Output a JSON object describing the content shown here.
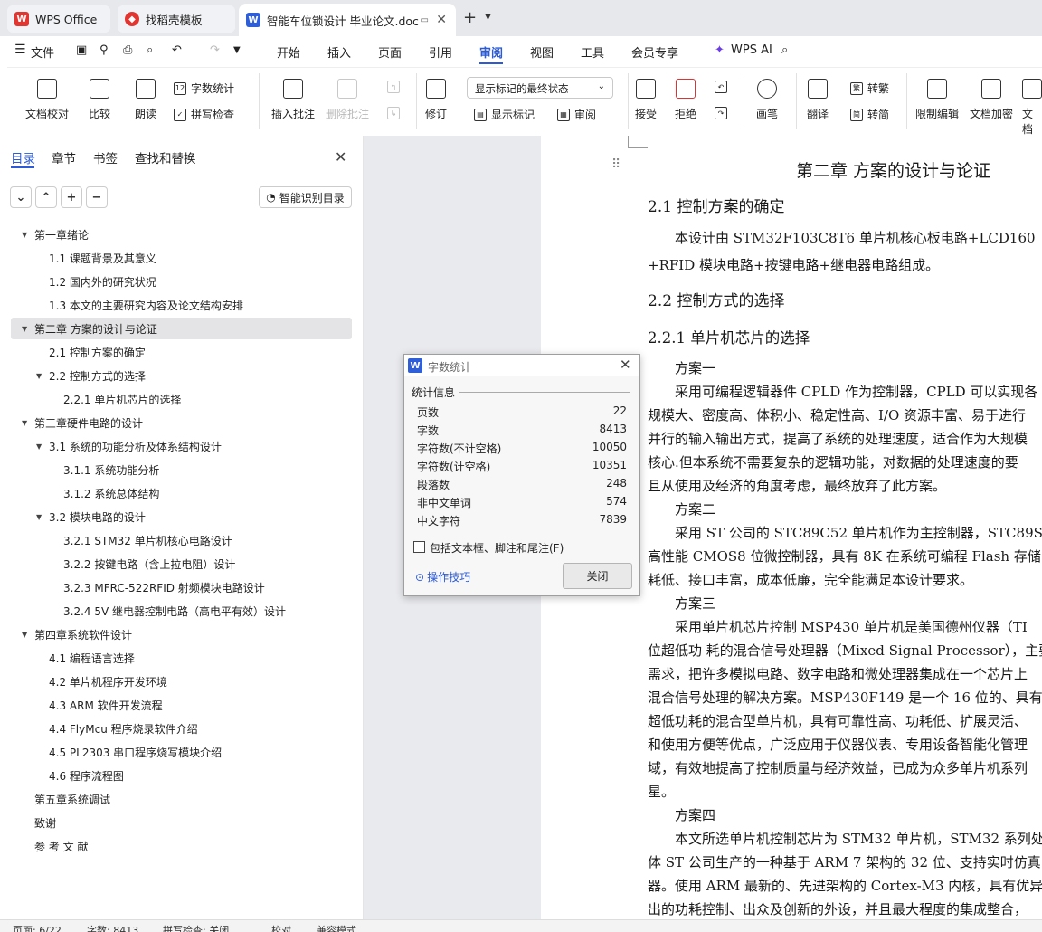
{
  "tabs": {
    "wps": "WPS Office",
    "template": "找稻壳模板",
    "doc": "智能车位锁设计 毕业论文.doc"
  },
  "menu": {
    "file": "文件",
    "items": [
      "开始",
      "插入",
      "页面",
      "引用",
      "审阅",
      "视图",
      "工具",
      "会员专享",
      "WPS AI"
    ]
  },
  "ribbon": {
    "doc_proof": "文档校对",
    "compare": "比较",
    "read": "朗读",
    "word_count": "字数统计",
    "spell_check": "拼写检查",
    "insert_comment": "插入批注",
    "delete_comment": "删除批注",
    "revise": "修订",
    "markup_state": "显示标记的最终状态",
    "show_markup": "显示标记",
    "review": "审阅",
    "accept": "接受",
    "reject": "拒绝",
    "pen": "画笔",
    "translate": "翻译",
    "to_traditional": "转繁",
    "to_simplified": "转简",
    "restrict_edit": "限制编辑",
    "doc_encrypt": "文档加密",
    "doc_cut": "文档"
  },
  "nav": {
    "tabs": [
      "目录",
      "章节",
      "书签",
      "查找和替换"
    ],
    "smart_toc": "智能识别目录",
    "toc": [
      "第一章绪论",
      "1.1 课题背景及其意义",
      "1.2 国内外的研究状况",
      "1.3 本文的主要研究内容及论文结构安排",
      "第二章  方案的设计与论证",
      "2.1 控制方案的确定",
      "2.2 控制方式的选择",
      "2.2.1  单片机芯片的选择",
      "第三章硬件电路的设计",
      "3.1 系统的功能分析及体系结构设计",
      "3.1.1 系统功能分析",
      "3.1.2 系统总体结构",
      "3.2 模块电路的设计",
      "3.2.1 STM32 单片机核心电路设计",
      "3.2.2  按键电路（含上拉电阻）设计",
      "3.2.3 MFRC-522RFID 射频模块电路设计",
      "3.2.4 5V 继电器控制电路（高电平有效）设计",
      "第四章系统软件设计",
      "4.1  编程语言选择",
      "4.2 单片机程序开发环境",
      "4.3 ARM 软件开发流程",
      "4.4 FlyMcu 程序烧录软件介绍",
      "4.5 PL2303 串口程序烧写模块介绍",
      "4.6  程序流程图",
      "第五章系统调试",
      "致谢",
      "参 考 文 献"
    ]
  },
  "dialog": {
    "title": "字数统计",
    "section": "统计信息",
    "stats": [
      {
        "label": "页数",
        "value": "22"
      },
      {
        "label": "字数",
        "value": "8413"
      },
      {
        "label": "字符数(不计空格)",
        "value": "10050"
      },
      {
        "label": "字符数(计空格)",
        "value": "10351"
      },
      {
        "label": "段落数",
        "value": "248"
      },
      {
        "label": "非中文单词",
        "value": "574"
      },
      {
        "label": "中文字符",
        "value": "7839"
      }
    ],
    "checkbox": "包括文本框、脚注和尾注(F)",
    "tips": "操作技巧",
    "close": "关闭"
  },
  "document": {
    "lines": [
      "第二章  方案的设计与论证",
      "2.1 控制方案的确定",
      "　　本设计由 STM32F103C8T6 单片机核心板电路+LCD160",
      "+RFID 模块电路+按键电路+继电器电路组成。",
      "2.2 控制方式的选择",
      "2.2.1  单片机芯片的选择",
      "　　方案一",
      "　　采用可编程逻辑器件 CPLD 作为控制器，CPLD 可以实现各",
      "规模大、密度高、体积小、稳定性高、I/O 资源丰富、易于进行",
      "并行的输入输出方式，提高了系统的处理速度，适合作为大规模",
      "核心.但本系统不需要复杂的逻辑功能，对数据的处理速度的要",
      "且从使用及经济的角度考虑，最终放弃了此方案。",
      "　　方案二",
      "　　采用 ST 公司的 STC89C52 单片机作为主控制器，STC89S5",
      "高性能 CMOS8 位微控制器，具有 8K 在系统可编程 Flash 存储",
      "耗低、接口丰富，成本低廉，完全能满足本设计要求。",
      "　　方案三",
      "　　采用单片机芯片控制 MSP430 单片机是美国德州仪器（TI",
      "位超低功 耗的混合信号处理器（Mixed Signal Processor），主要",
      "需求，把许多模拟电路、数字电路和微处理器集成在一个芯片上",
      "混合信号处理的解决方案。MSP430F149 是一个 16 位的、具有",
      "超低功耗的混合型单片机，具有可靠性高、功耗低、扩展灵活、",
      "和使用方便等优点，广泛应用于仪器仪表、专用设备智能化管理",
      "域，有效地提高了控制质量与经济效益，已成为众多单片机系列",
      "星。",
      "　　方案四",
      "　　本文所选单片机控制芯片为 STM32 单片机，STM32 系列处",
      "体 ST 公司生产的一种基于 ARM 7 架构的 32 位、支持实时仿真",
      "器。使用 ARM 最新的、先进架构的 Cortex-M3 内核，具有优异",
      "出的功耗控制、出众及创新的外设，并且最大程度的集成整合，"
    ]
  },
  "status": {
    "page": "页面: 6/22",
    "words": "字数: 8413",
    "spell": "拼写检查: 关闭",
    "proof": "校对",
    "compat": "兼容模式"
  }
}
